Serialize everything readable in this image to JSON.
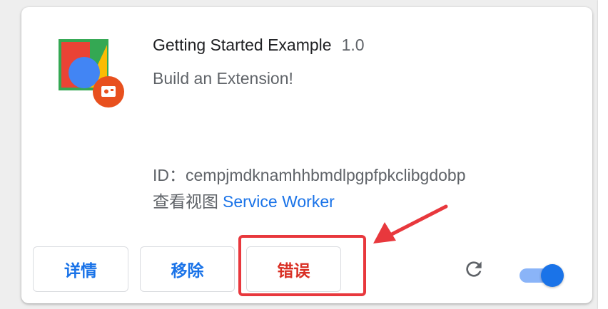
{
  "extension": {
    "name": "Getting Started Example",
    "version": "1.0",
    "description": "Build an Extension!",
    "id_label": "ID：",
    "id_value": "cempjmdknamhhbmdlpgpfpkclibgdobp",
    "views_label": "查看视图",
    "views_link": "Service Worker",
    "icon_name": "extension-logo-icon"
  },
  "buttons": {
    "details": "详情",
    "remove": "移除",
    "errors": "错误"
  },
  "controls": {
    "reload_icon": "reload-icon",
    "toggle_state": "on"
  },
  "colors": {
    "link": "#1a73e8",
    "error": "#d93025",
    "annotation": "#e8383d"
  }
}
